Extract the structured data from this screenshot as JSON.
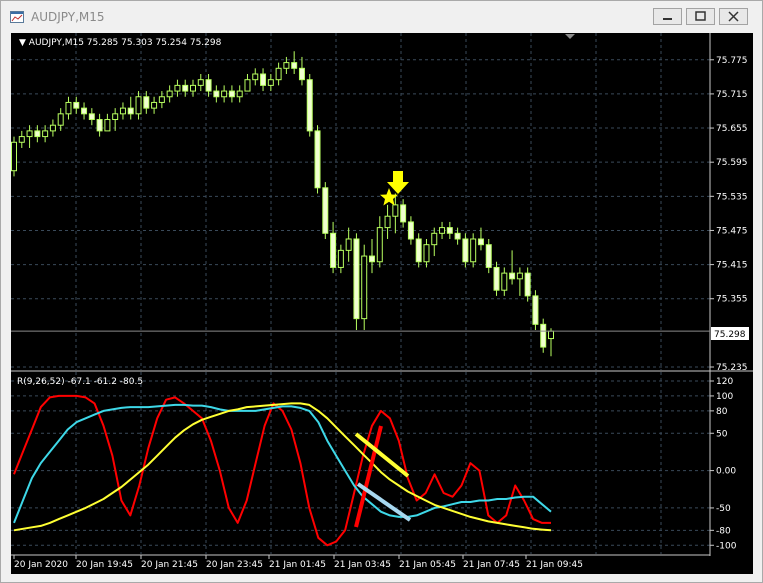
{
  "window": {
    "title": "AUDJPY,M15",
    "buttons": {
      "minimize": "minimize",
      "maximize": "maximize",
      "close": "close"
    }
  },
  "colors": {
    "background": "#000000",
    "grid": "#3a4a5a",
    "axis_text": "#ffffff",
    "bull_candle": "#f0ffd0",
    "bear_candle": "#f0ffd0",
    "wick": "#b8ff60",
    "arrow": "#ffff00",
    "star": "#ffff00",
    "red_line": "#ff0000",
    "cyan_line": "#3ed8e8",
    "yellow_line": "#ffff33",
    "price_line": "#8a8a8a"
  },
  "chart_data": [
    {
      "type": "candlestick",
      "header": "AUDJPY,M15  75.285 75.303 75.254 75.298",
      "current_price_label": "75.298",
      "current_price": 75.298,
      "y_ticks": [
        "75.775",
        "75.715",
        "75.655",
        "75.595",
        "75.535",
        "75.475",
        "75.415",
        "75.355",
        "75.235"
      ],
      "ylim": [
        75.235,
        75.808
      ],
      "grid": true,
      "candles": [
        [
          75.58,
          75.64,
          75.57,
          75.63
        ],
        [
          75.63,
          75.65,
          75.62,
          75.64
        ],
        [
          75.64,
          75.66,
          75.62,
          75.65
        ],
        [
          75.65,
          75.66,
          75.63,
          75.64
        ],
        [
          75.64,
          75.66,
          75.63,
          75.65
        ],
        [
          75.65,
          75.67,
          75.64,
          75.66
        ],
        [
          75.66,
          75.69,
          75.65,
          75.68
        ],
        [
          75.68,
          75.71,
          75.67,
          75.7
        ],
        [
          75.7,
          75.71,
          75.68,
          75.69
        ],
        [
          75.69,
          75.7,
          75.67,
          75.68
        ],
        [
          75.68,
          75.69,
          75.66,
          75.67
        ],
        [
          75.67,
          75.68,
          75.64,
          75.65
        ],
        [
          75.65,
          75.68,
          75.65,
          75.67
        ],
        [
          75.67,
          75.69,
          75.65,
          75.68
        ],
        [
          75.68,
          75.7,
          75.67,
          75.69
        ],
        [
          75.69,
          75.71,
          75.67,
          75.68
        ],
        [
          75.68,
          75.72,
          75.67,
          75.71
        ],
        [
          75.71,
          75.72,
          75.68,
          75.69
        ],
        [
          75.69,
          75.71,
          75.68,
          75.7
        ],
        [
          75.7,
          75.72,
          75.69,
          75.71
        ],
        [
          75.71,
          75.73,
          75.7,
          75.72
        ],
        [
          75.72,
          75.74,
          75.71,
          75.73
        ],
        [
          75.73,
          75.74,
          75.71,
          75.72
        ],
        [
          75.72,
          75.74,
          75.71,
          75.73
        ],
        [
          75.73,
          75.75,
          75.72,
          75.74
        ],
        [
          75.74,
          75.75,
          75.71,
          75.72
        ],
        [
          75.72,
          75.73,
          75.7,
          75.71
        ],
        [
          75.71,
          75.73,
          75.7,
          75.72
        ],
        [
          75.72,
          75.73,
          75.7,
          75.71
        ],
        [
          75.71,
          75.73,
          75.7,
          75.72
        ],
        [
          75.72,
          75.75,
          75.72,
          75.74
        ],
        [
          75.74,
          75.76,
          75.73,
          75.75
        ],
        [
          75.75,
          75.76,
          75.72,
          75.73
        ],
        [
          75.73,
          75.75,
          75.72,
          75.74
        ],
        [
          75.74,
          75.77,
          75.73,
          75.76
        ],
        [
          75.76,
          75.78,
          75.75,
          75.77
        ],
        [
          75.77,
          75.79,
          75.75,
          75.76
        ],
        [
          75.76,
          75.78,
          75.73,
          75.74
        ],
        [
          75.74,
          75.75,
          75.64,
          75.65
        ],
        [
          75.65,
          75.66,
          75.54,
          75.55
        ],
        [
          75.55,
          75.56,
          75.46,
          75.47
        ],
        [
          75.47,
          75.49,
          75.4,
          75.41
        ],
        [
          75.41,
          75.45,
          75.4,
          75.44
        ],
        [
          75.44,
          75.48,
          75.42,
          75.46
        ],
        [
          75.46,
          75.47,
          75.3,
          75.32
        ],
        [
          75.32,
          75.45,
          75.3,
          75.43
        ],
        [
          75.43,
          75.46,
          75.4,
          75.42
        ],
        [
          75.42,
          75.5,
          75.41,
          75.48
        ],
        [
          75.48,
          75.52,
          75.46,
          75.5
        ],
        [
          75.5,
          75.54,
          75.47,
          75.52
        ],
        [
          75.52,
          75.53,
          75.48,
          75.49
        ],
        [
          75.49,
          75.5,
          75.45,
          75.46
        ],
        [
          75.46,
          75.47,
          75.41,
          75.42
        ],
        [
          75.42,
          75.46,
          75.41,
          75.45
        ],
        [
          75.45,
          75.48,
          75.43,
          75.47
        ],
        [
          75.47,
          75.49,
          75.46,
          75.48
        ],
        [
          75.48,
          75.49,
          75.46,
          75.47
        ],
        [
          75.47,
          75.48,
          75.45,
          75.46
        ],
        [
          75.46,
          75.47,
          75.41,
          75.42
        ],
        [
          75.42,
          75.47,
          75.41,
          75.46
        ],
        [
          75.46,
          75.48,
          75.44,
          75.45
        ],
        [
          75.45,
          75.46,
          75.4,
          75.41
        ],
        [
          75.41,
          75.42,
          75.36,
          75.37
        ],
        [
          75.37,
          75.41,
          75.36,
          75.4
        ],
        [
          75.4,
          75.44,
          75.38,
          75.39
        ],
        [
          75.39,
          75.41,
          75.36,
          75.4
        ],
        [
          75.4,
          75.41,
          75.35,
          75.36
        ],
        [
          75.36,
          75.37,
          75.3,
          75.31
        ],
        [
          75.31,
          75.32,
          75.26,
          75.27
        ],
        [
          75.285,
          75.303,
          75.254,
          75.298
        ]
      ]
    },
    {
      "type": "line",
      "header": "R(9,26,52) -67.1 -61.2 -80.5",
      "y_ticks": [
        "120",
        "100",
        "80",
        "50",
        "0.00",
        "-50",
        "-80",
        "-100"
      ],
      "ylim": [
        -105,
        120
      ],
      "x_labels": [
        "20 Jan 2020",
        "20 Jan 19:45",
        "20 Jan 21:45",
        "20 Jan 23:45",
        "21 Jan 01:45",
        "21 Jan 03:45",
        "21 Jan 05:45",
        "21 Jan 07:45",
        "21 Jan 09:45"
      ],
      "grid": true,
      "series": [
        {
          "color": "#ff0000",
          "values": [
            -5,
            25,
            55,
            85,
            98,
            100,
            100,
            100,
            98,
            90,
            60,
            20,
            -40,
            -60,
            -20,
            30,
            70,
            95,
            98,
            90,
            80,
            70,
            40,
            0,
            -50,
            -70,
            -40,
            10,
            60,
            90,
            80,
            55,
            10,
            -50,
            -90,
            -100,
            -95,
            -80,
            -30,
            20,
            60,
            80,
            70,
            40,
            -10,
            -40,
            -30,
            -5,
            -30,
            -35,
            -20,
            10,
            0,
            -60,
            -70,
            -60,
            -20,
            -40,
            -65,
            -70,
            -70
          ]
        },
        {
          "color": "#3ed8e8",
          "values": [
            -70,
            -40,
            -10,
            10,
            25,
            40,
            55,
            65,
            70,
            75,
            80,
            82,
            84,
            85,
            85,
            85,
            86,
            87,
            88,
            88,
            87,
            87,
            85,
            82,
            80,
            80,
            80,
            80,
            82,
            84,
            86,
            86,
            84,
            80,
            65,
            40,
            20,
            0,
            -20,
            -35,
            -45,
            -55,
            -60,
            -62,
            -62,
            -60,
            -55,
            -50,
            -48,
            -45,
            -42,
            -42,
            -40,
            -40,
            -38,
            -38,
            -36,
            -35,
            -35,
            -45,
            -55
          ]
        },
        {
          "color": "#ffff33",
          "values": [
            -80,
            -78,
            -76,
            -74,
            -70,
            -65,
            -60,
            -55,
            -50,
            -44,
            -38,
            -30,
            -22,
            -12,
            -2,
            8,
            20,
            32,
            44,
            54,
            62,
            68,
            72,
            76,
            80,
            82,
            85,
            86,
            87,
            88,
            89,
            90,
            90,
            88,
            80,
            70,
            58,
            46,
            34,
            22,
            10,
            -2,
            -12,
            -20,
            -28,
            -34,
            -40,
            -46,
            -50,
            -54,
            -58,
            -62,
            -65,
            -68,
            -70,
            -72,
            -74,
            -76,
            -78,
            -79,
            -80
          ]
        },
        {
          "color": "#ff0000",
          "thick": true,
          "values": []
        }
      ]
    }
  ]
}
